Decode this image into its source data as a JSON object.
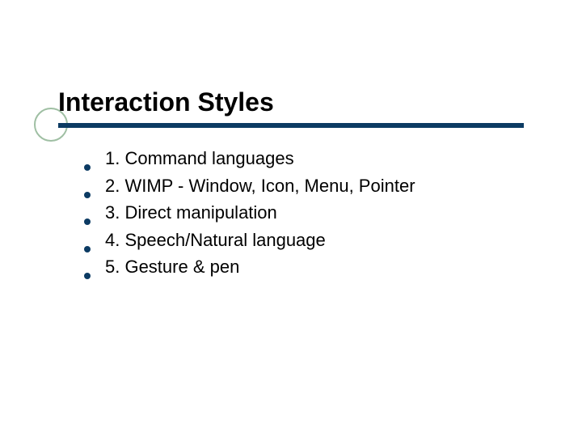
{
  "slide": {
    "title": "Interaction Styles",
    "items": [
      "1. Command languages",
      "2. WIMP - Window, Icon, Menu, Pointer",
      "3. Direct manipulation",
      "4. Speech/Natural language",
      "5. Gesture & pen"
    ]
  }
}
